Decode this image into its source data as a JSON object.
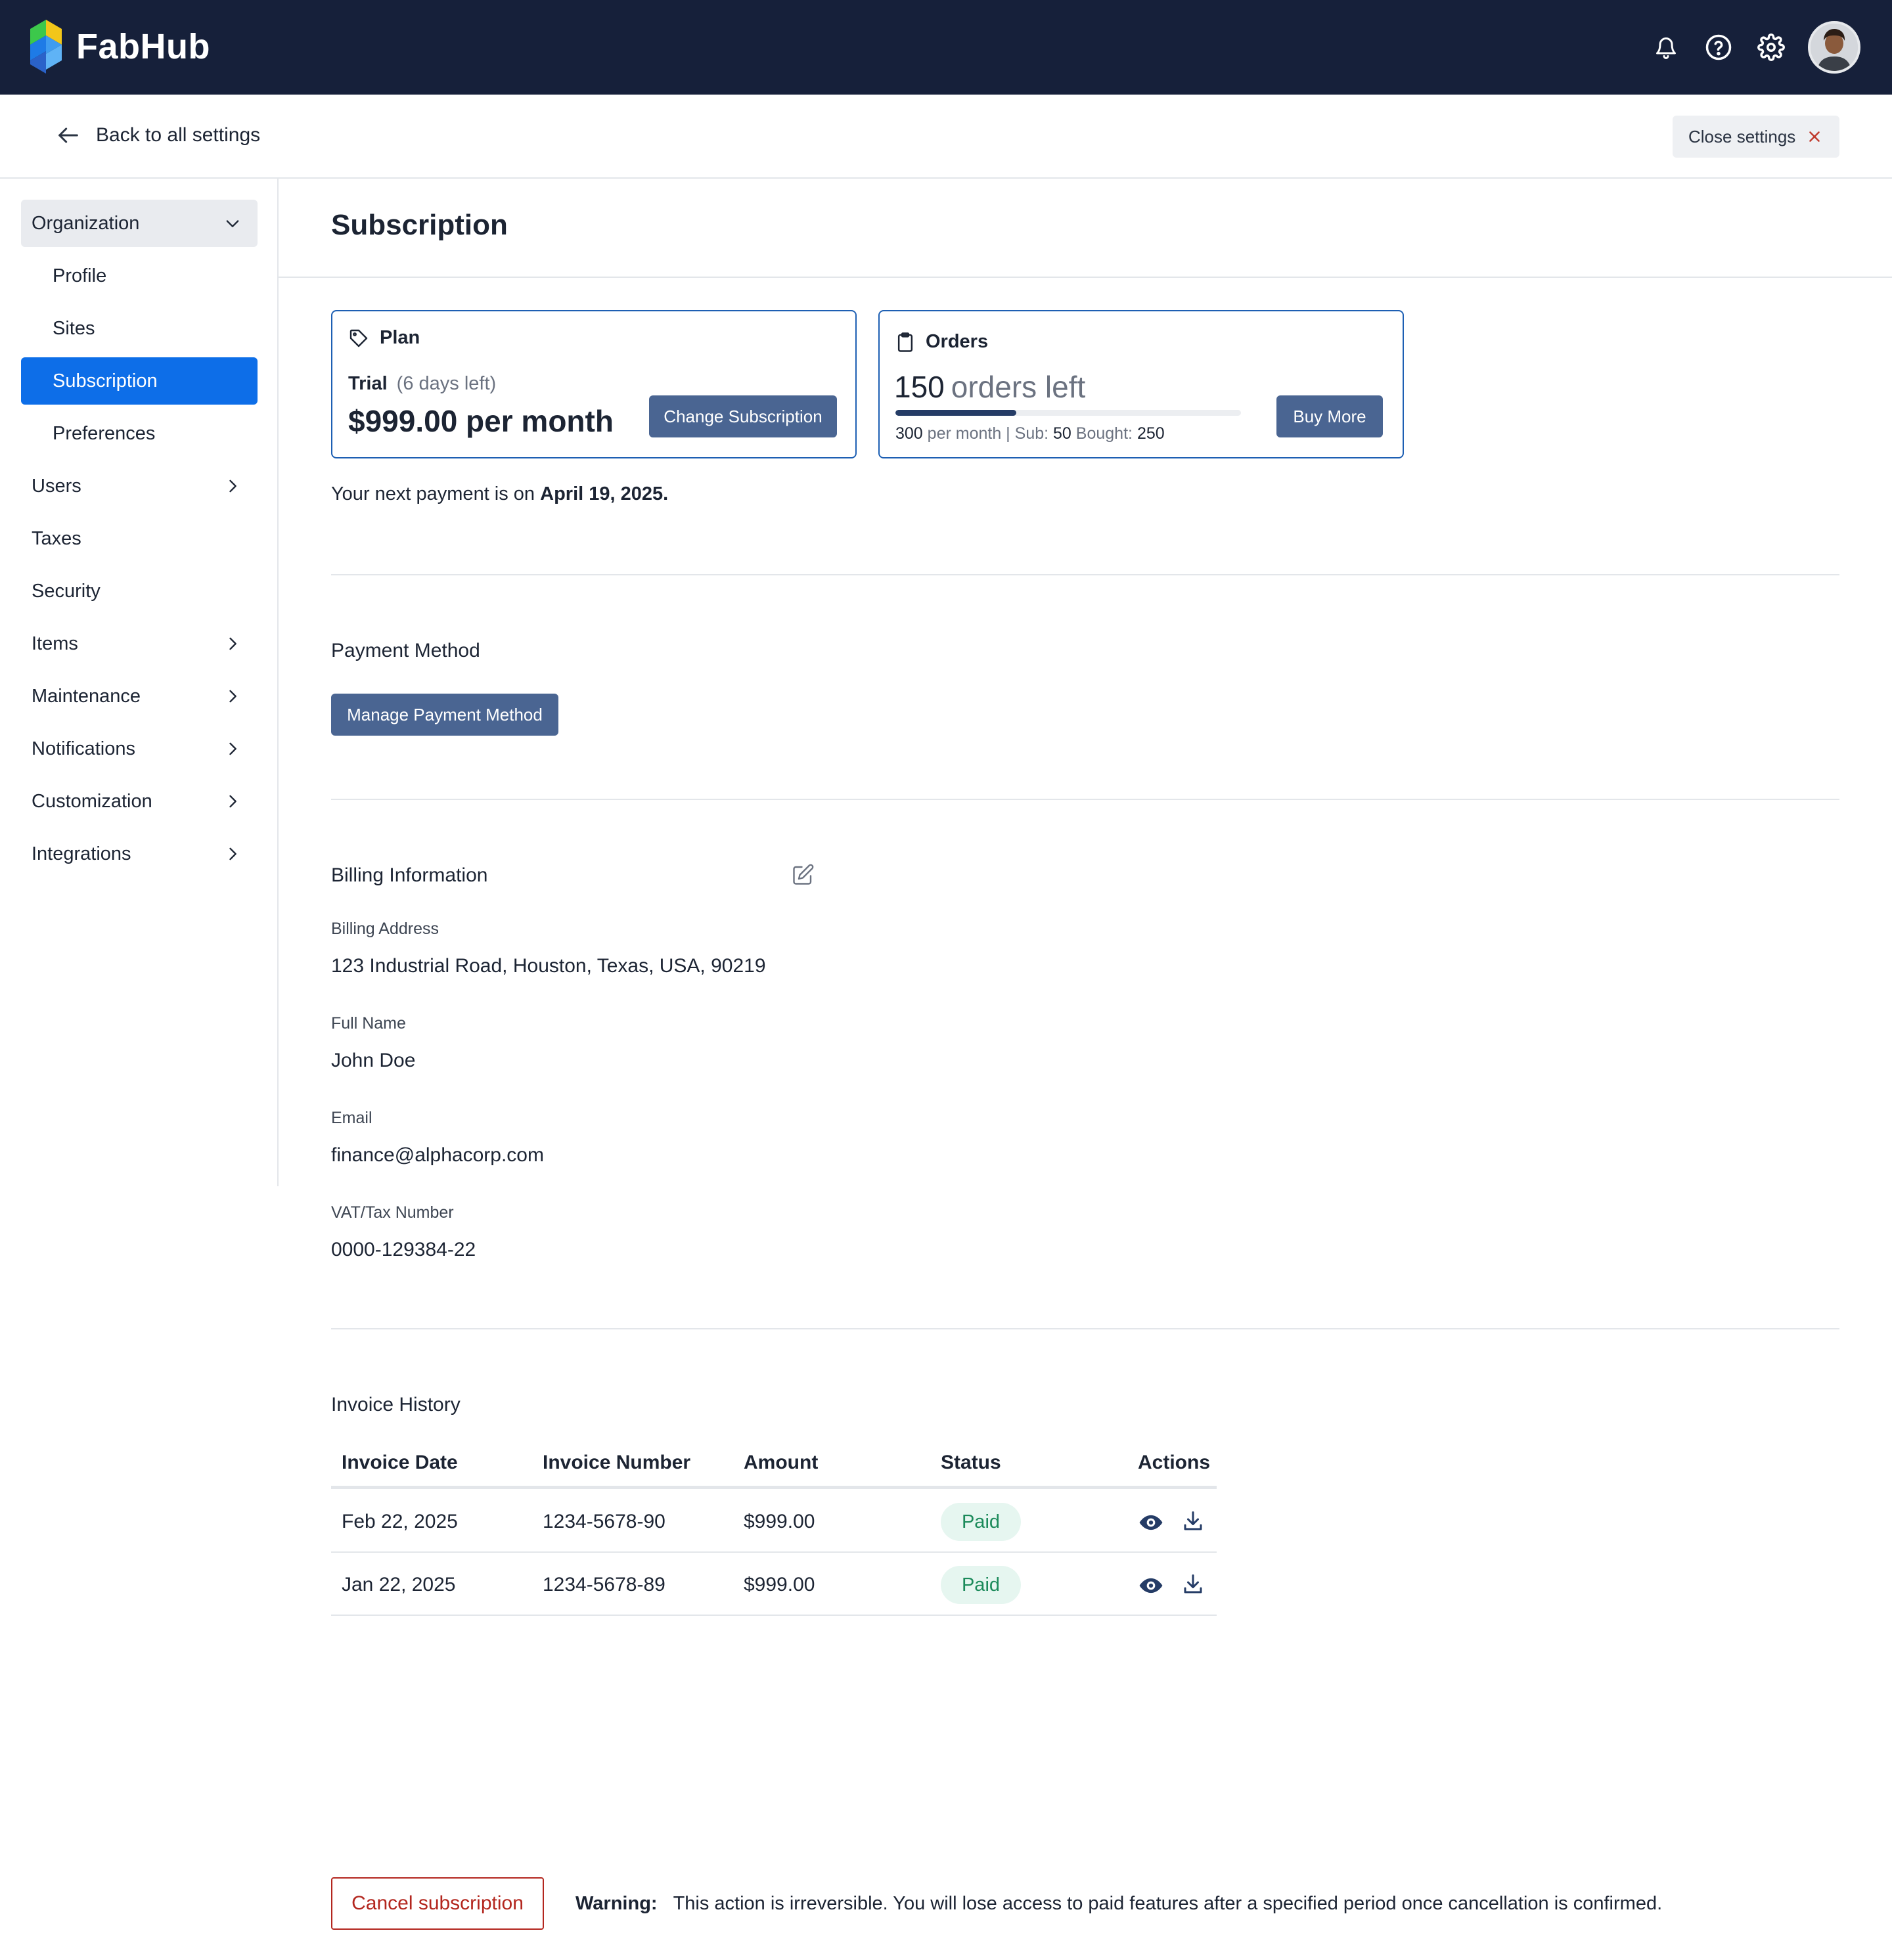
{
  "app": {
    "name": "FabHub",
    "brand_color": "#16203a",
    "accent_color": "#0d6ee8"
  },
  "topbar": {
    "icons": [
      "bell-icon",
      "help-icon",
      "gear-icon"
    ],
    "avatar": "user-avatar"
  },
  "subheader": {
    "back_label": "Back to all settings",
    "close_label": "Close settings"
  },
  "sidebar": {
    "group": "Organization",
    "sub_items": [
      "Profile",
      "Sites",
      "Subscription",
      "Preferences"
    ],
    "active": "Subscription",
    "items": [
      {
        "label": "Users",
        "chevron": true
      },
      {
        "label": "Taxes",
        "chevron": false
      },
      {
        "label": "Security",
        "chevron": false
      },
      {
        "label": "Items",
        "chevron": true
      },
      {
        "label": "Maintenance",
        "chevron": true
      },
      {
        "label": "Notifications",
        "chevron": true
      },
      {
        "label": "Customization",
        "chevron": true
      },
      {
        "label": "Integrations",
        "chevron": true
      }
    ]
  },
  "page": {
    "title": "Subscription"
  },
  "plan_card": {
    "heading": "Plan",
    "plan_name": "Trial",
    "days_left": "(6 days left)",
    "price": "$999.00 per month",
    "change_button": "Change Subscription"
  },
  "orders_card": {
    "heading": "Orders",
    "count": "150",
    "count_suffix": "orders left",
    "progress_fraction": 0.35,
    "per_month_value": "300",
    "per_month_label": "per month |",
    "sub_label": "Sub:",
    "sub_value": "50",
    "bought_label": "Bought:",
    "bought_value": "250",
    "buy_button": "Buy More"
  },
  "next_payment": {
    "prefix": "Your next payment is on",
    "date": "April 19, 2025."
  },
  "payment_method": {
    "title": "Payment Method",
    "button": "Manage Payment Method"
  },
  "billing": {
    "title": "Billing Information",
    "address_label": "Billing Address",
    "address": "123 Industrial Road, Houston, Texas, USA, 90219",
    "name_label": "Full Name",
    "name": "John Doe",
    "email_label": "Email",
    "email": "finance@alphacorp.com",
    "vat_label": "VAT/Tax Number",
    "vat": "0000-129384-22"
  },
  "invoices": {
    "title": "Invoice History",
    "columns": [
      "Invoice Date",
      "Invoice Number",
      "Amount",
      "Status",
      "Actions"
    ],
    "rows": [
      {
        "date": "Feb 22, 2025",
        "number": "1234-5678-90",
        "amount": "$999.00",
        "status": "Paid"
      },
      {
        "date": "Jan 22, 2025",
        "number": "1234-5678-89",
        "amount": "$999.00",
        "status": "Paid"
      }
    ]
  },
  "cancel": {
    "button": "Cancel subscription",
    "warning_label": "Warning:",
    "warning_text": "This action is irreversible. You will lose access to paid features after a specified period once cancellation is confirmed."
  }
}
